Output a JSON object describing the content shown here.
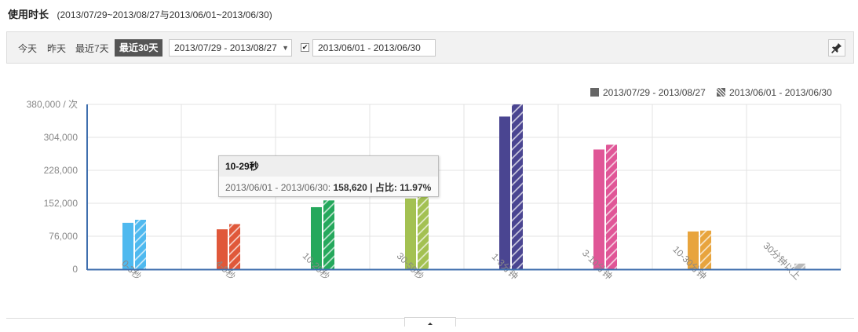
{
  "header": {
    "title": "使用时长",
    "range_text": "(2013/07/29~2013/08/27与2013/06/01~2013/06/30)"
  },
  "toolbar": {
    "today": "今天",
    "yesterday": "昨天",
    "last7": "最近7天",
    "last30": "最近30天",
    "range1": "2013/07/29 - 2013/08/27",
    "range2": "2013/06/01 - 2013/06/30",
    "compare_checked": true,
    "pin_icon": "pin-icon"
  },
  "chart_data": {
    "type": "bar",
    "categories": [
      "0-3秒",
      "4-9秒",
      "10-29秒",
      "30-59秒",
      "1-3分钟",
      "3-10分钟",
      "10-30分钟",
      "30分钟以上"
    ],
    "series": [
      {
        "name": "2013/07/29 - 2013/08/27",
        "values": [
          107000,
          92000,
          143000,
          163000,
          352000,
          276000,
          87000,
          0
        ]
      },
      {
        "name": "2013/06/01 - 2013/06/30",
        "values": [
          114000,
          104000,
          158620,
          172000,
          380000,
          287000,
          89000,
          13000
        ]
      }
    ],
    "colors": [
      "#4fb9ef",
      "#e0583a",
      "#25a85c",
      "#a3c152",
      "#4a4591",
      "#e05697",
      "#e8a43d",
      "#b9b9b9"
    ],
    "ylabel_unit": "次",
    "yticks": [
      "0",
      "76,000",
      "152,000",
      "228,000",
      "304,000",
      "380,000 / 次"
    ],
    "ylim": [
      0,
      380000
    ],
    "grid": true,
    "legend_position": "top-right",
    "second_series_pattern": "hatched"
  },
  "legend": {
    "items": [
      "2013/07/29 - 2013/08/27",
      "2013/06/01 - 2013/06/30"
    ]
  },
  "tooltip": {
    "title": "10-29秒",
    "series_label": "2013/06/01 - 2013/06/30:",
    "value": "158,620",
    "share_label": "| 占比:",
    "share_value": "11.97%"
  }
}
